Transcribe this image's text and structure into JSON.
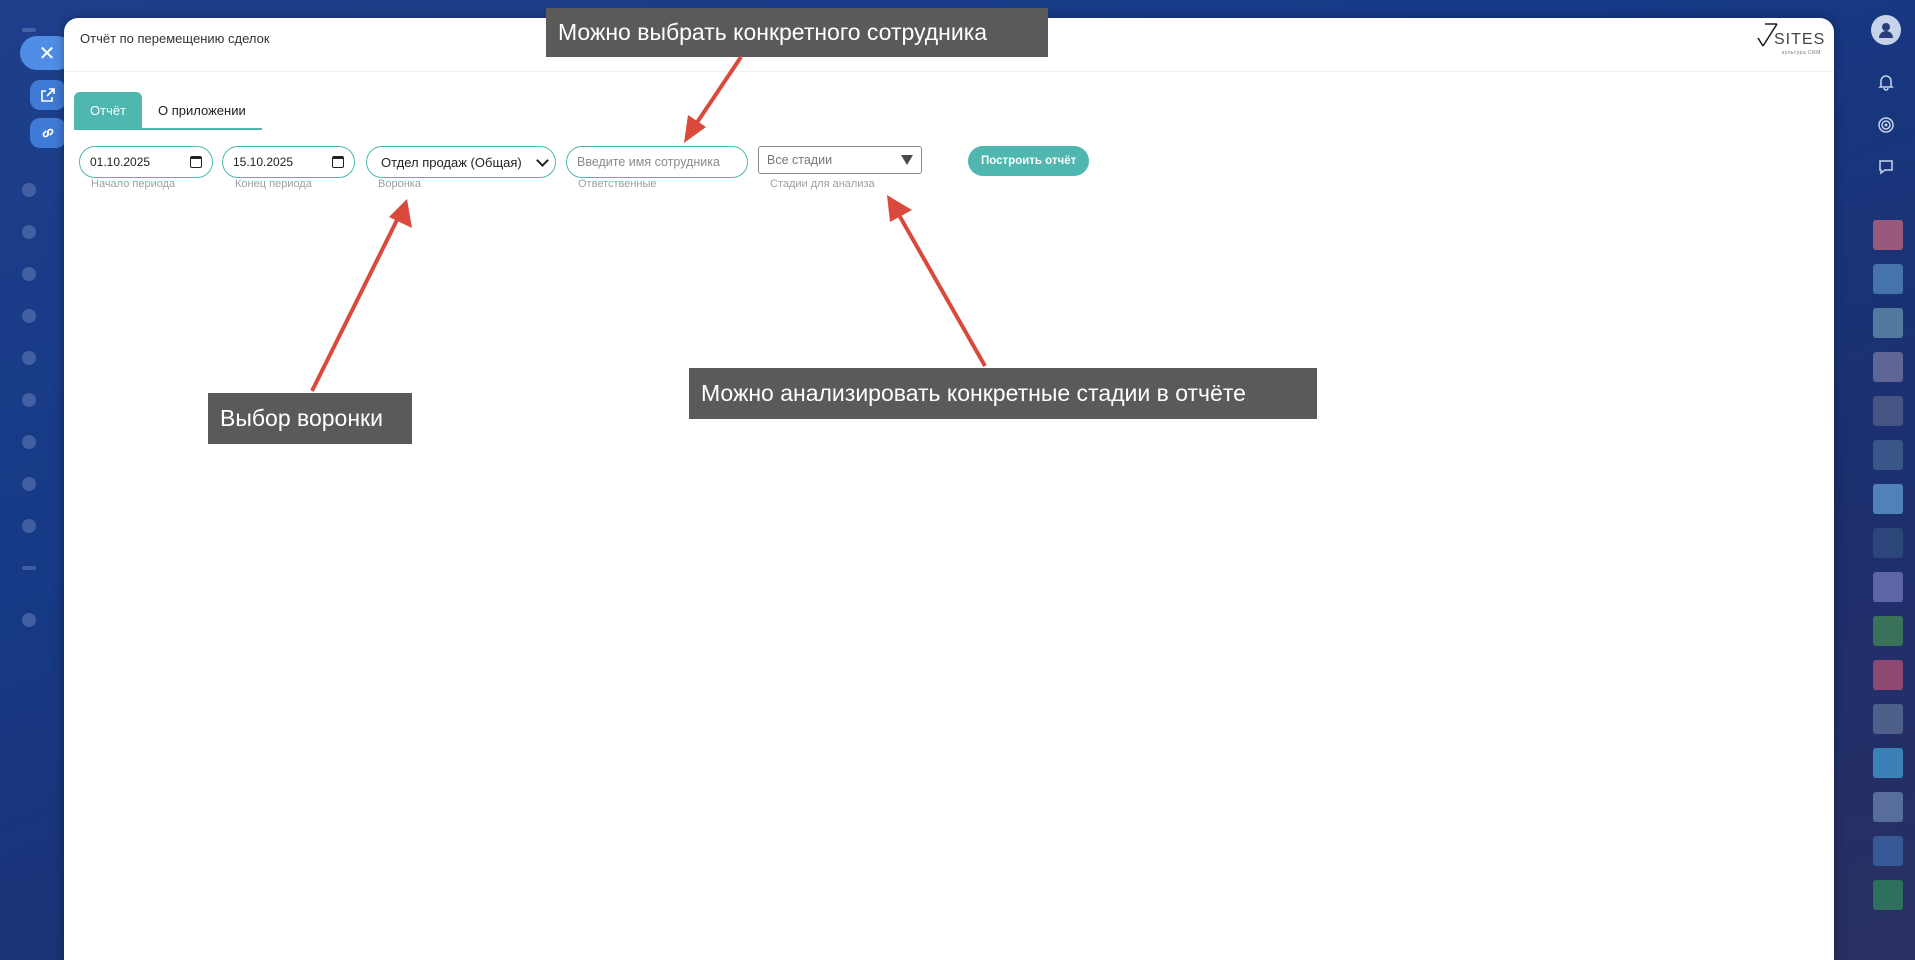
{
  "panel": {
    "title": "Отчёт по перемещению сделок",
    "logo_text": "SITES",
    "logo_sub": "культура CRM"
  },
  "tabs": [
    {
      "label": "Отчёт",
      "active": true
    },
    {
      "label": "О приложении",
      "active": false
    }
  ],
  "filters": {
    "start_date": {
      "value": "01.10.2025",
      "hint": "Начало периода"
    },
    "end_date": {
      "value": "15.10.2025",
      "hint": "Конец периода"
    },
    "funnel": {
      "value": "Отдел продаж (Общая)",
      "hint": "Воронка"
    },
    "employee": {
      "placeholder": "Введите имя сотрудника",
      "hint": "Ответственные"
    },
    "stages": {
      "value": "Все стадии",
      "hint": "Стадии для анализа"
    },
    "build_button": "Построить отчёт"
  },
  "annotations": {
    "employee_note": "Можно выбрать конкретного сотрудника",
    "funnel_note": "Выбор воронки",
    "stages_note": "Можно анализировать конкретные стадии в отчёте"
  },
  "colors": {
    "accent": "#4fb7b0",
    "callout_bg": "#5a5a59",
    "arrow": "#d94a3d"
  },
  "icons": [
    "close-icon",
    "external-link-icon",
    "link-icon",
    "calendar-icon",
    "chevron-down-icon",
    "triangle-down-icon",
    "user-avatar-icon",
    "bell-icon",
    "target-icon",
    "chat-icon"
  ]
}
